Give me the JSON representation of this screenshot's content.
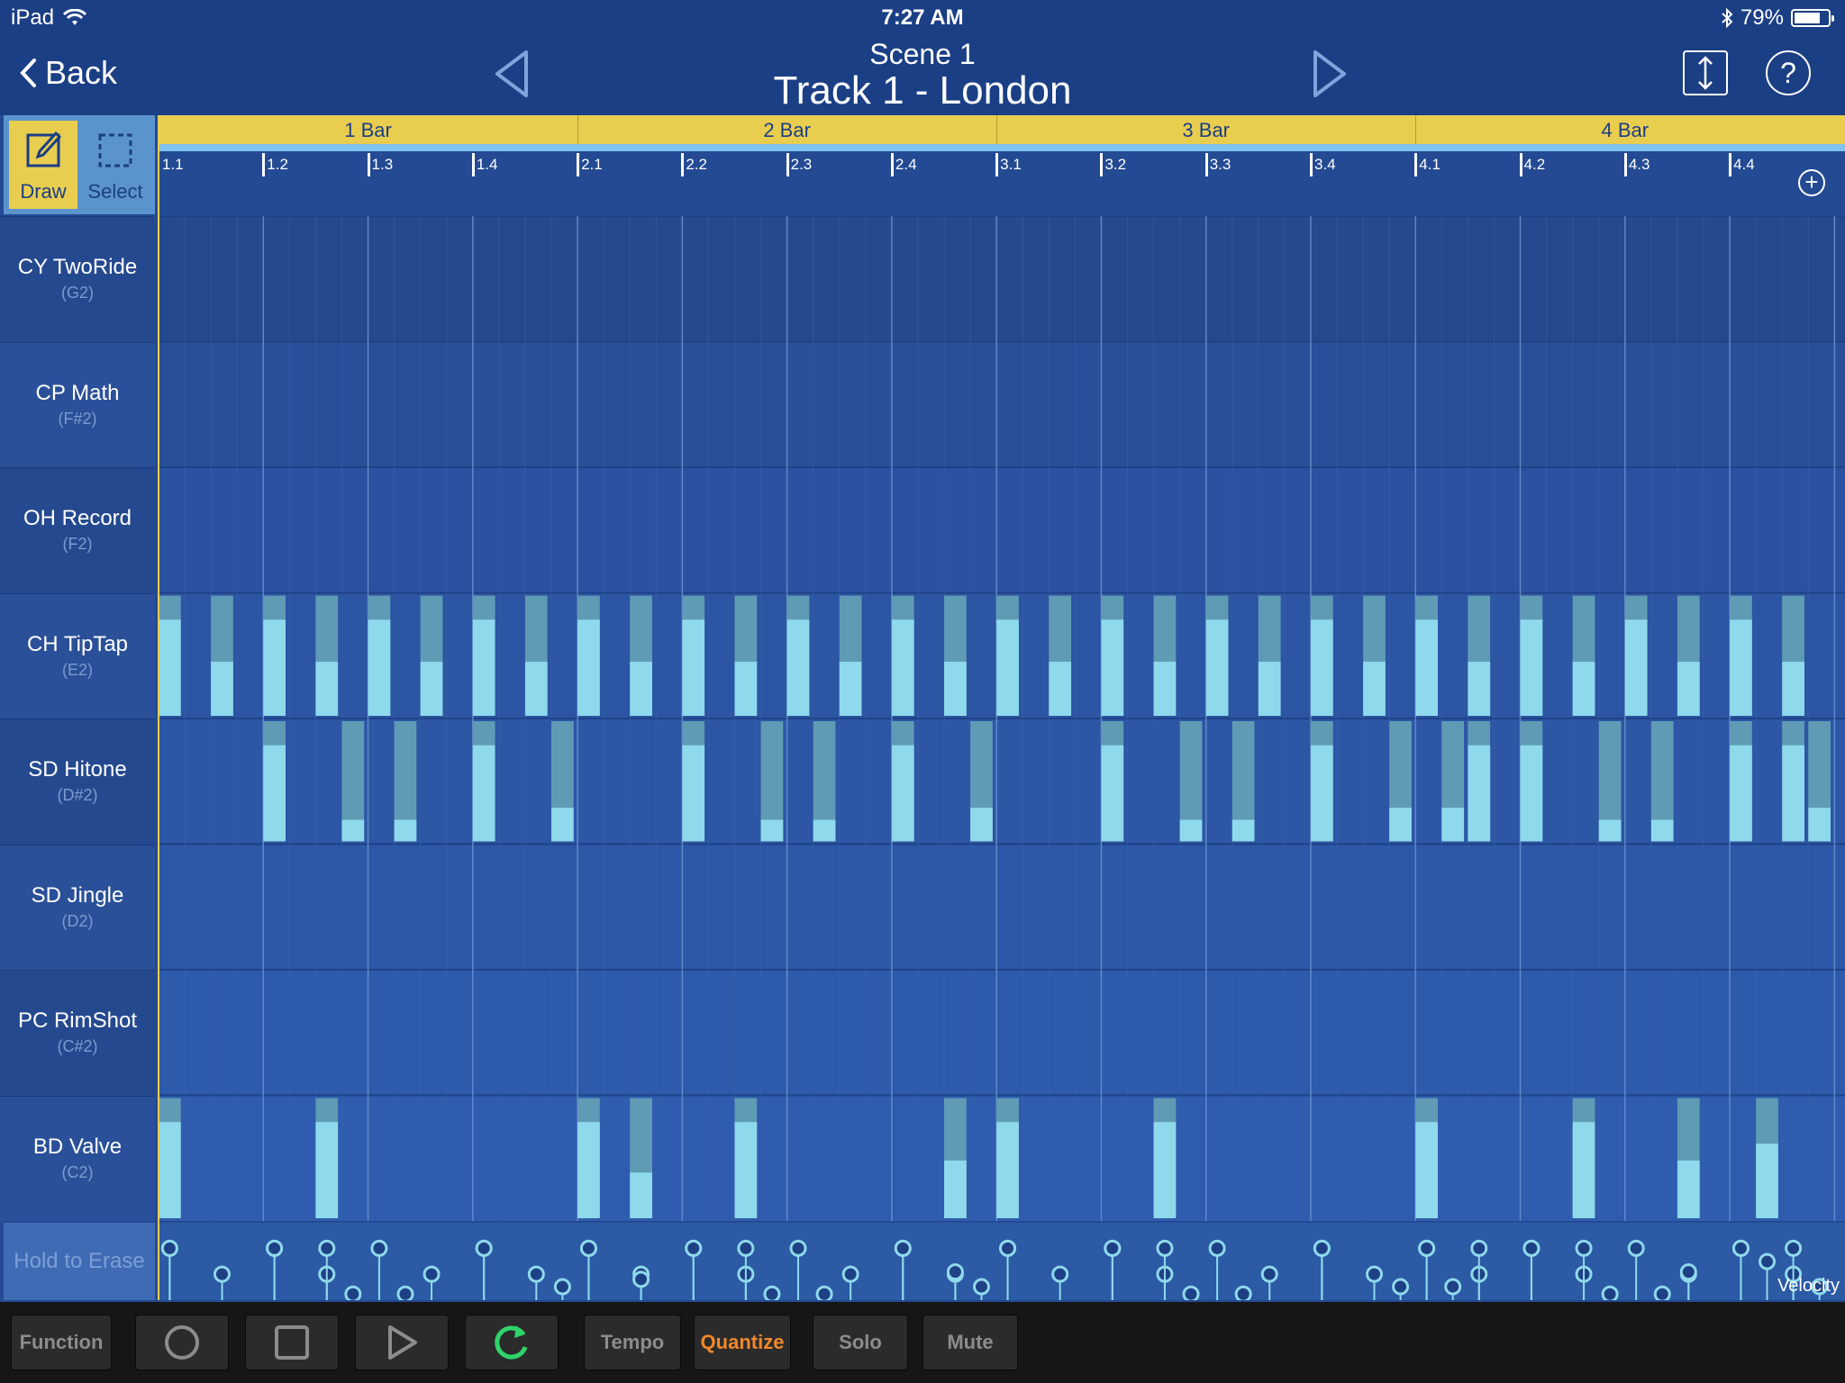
{
  "status_bar": {
    "device": "iPad",
    "time": "7:27 AM",
    "battery": "79%",
    "battery_level": 0.79
  },
  "nav": {
    "back_label": "Back",
    "scene": "Scene  1",
    "track_title": "Track 1 - London"
  },
  "tools": {
    "draw": "Draw",
    "select": "Select"
  },
  "bars": [
    "1 Bar",
    "2 Bar",
    "3 Bar",
    "4 Bar"
  ],
  "beats": [
    "1.1",
    "1.2",
    "1.3",
    "1.4",
    "2.1",
    "2.2",
    "2.3",
    "2.4",
    "3.1",
    "3.2",
    "3.3",
    "3.4",
    "4.1",
    "4.2",
    "4.3",
    "4.4"
  ],
  "instruments": [
    {
      "name": "CY TwoRide",
      "note": "(G2)"
    },
    {
      "name": "CP Math",
      "note": "(F#2)"
    },
    {
      "name": "OH Record",
      "note": "(F2)"
    },
    {
      "name": "CH TipTap",
      "note": "(E2)"
    },
    {
      "name": "SD Hitone",
      "note": "(D#2)"
    },
    {
      "name": "SD Jingle",
      "note": "(D2)"
    },
    {
      "name": "PC RimShot",
      "note": "(C#2)"
    },
    {
      "name": "BD Valve",
      "note": "(C2)"
    }
  ],
  "hold_to_erase": "Hold to Erase",
  "velocity_label": "Velocity",
  "colors": {
    "accent": "#e9cd4f",
    "note_fill": "#8fd9ec",
    "note_dim": "#5f9bb5",
    "quantize": "#f2882b"
  },
  "toolbar": {
    "function": "Function",
    "tempo": "Tempo",
    "quantize": "Quantize",
    "solo": "Solo",
    "mute": "Mute"
  },
  "pattern": [
    {
      "row": 3,
      "notes": [
        {
          "s": 0,
          "v": 0.8
        },
        {
          "s": 2,
          "v": 0.45
        },
        {
          "s": 4,
          "v": 0.8
        },
        {
          "s": 6,
          "v": 0.45
        },
        {
          "s": 8,
          "v": 0.8
        },
        {
          "s": 10,
          "v": 0.45
        },
        {
          "s": 12,
          "v": 0.8
        },
        {
          "s": 14,
          "v": 0.45
        },
        {
          "s": 16,
          "v": 0.8
        },
        {
          "s": 18,
          "v": 0.45
        },
        {
          "s": 20,
          "v": 0.8
        },
        {
          "s": 22,
          "v": 0.45
        },
        {
          "s": 24,
          "v": 0.8
        },
        {
          "s": 26,
          "v": 0.45
        },
        {
          "s": 28,
          "v": 0.8
        },
        {
          "s": 30,
          "v": 0.45
        },
        {
          "s": 32,
          "v": 0.8
        },
        {
          "s": 34,
          "v": 0.45
        },
        {
          "s": 36,
          "v": 0.8
        },
        {
          "s": 38,
          "v": 0.45
        },
        {
          "s": 40,
          "v": 0.8
        },
        {
          "s": 42,
          "v": 0.45
        },
        {
          "s": 44,
          "v": 0.8
        },
        {
          "s": 46,
          "v": 0.45
        },
        {
          "s": 48,
          "v": 0.8
        },
        {
          "s": 50,
          "v": 0.45
        },
        {
          "s": 52,
          "v": 0.8
        },
        {
          "s": 54,
          "v": 0.45
        },
        {
          "s": 56,
          "v": 0.8
        },
        {
          "s": 58,
          "v": 0.45
        },
        {
          "s": 60,
          "v": 0.8
        },
        {
          "s": 62,
          "v": 0.45
        }
      ]
    },
    {
      "row": 4,
      "notes": [
        {
          "s": 4,
          "v": 0.8
        },
        {
          "s": 7,
          "v": 0.18
        },
        {
          "s": 9,
          "v": 0.18
        },
        {
          "s": 12,
          "v": 0.8
        },
        {
          "s": 15,
          "v": 0.28
        },
        {
          "s": 20,
          "v": 0.8
        },
        {
          "s": 23,
          "v": 0.18
        },
        {
          "s": 25,
          "v": 0.18
        },
        {
          "s": 28,
          "v": 0.8
        },
        {
          "s": 31,
          "v": 0.28
        },
        {
          "s": 36,
          "v": 0.8
        },
        {
          "s": 39,
          "v": 0.18
        },
        {
          "s": 41,
          "v": 0.18
        },
        {
          "s": 44,
          "v": 0.8
        },
        {
          "s": 47,
          "v": 0.28
        },
        {
          "s": 49,
          "v": 0.28
        },
        {
          "s": 50,
          "v": 0.8
        },
        {
          "s": 52,
          "v": 0.8
        },
        {
          "s": 55,
          "v": 0.18
        },
        {
          "s": 57,
          "v": 0.18
        },
        {
          "s": 60,
          "v": 0.8
        },
        {
          "s": 62,
          "v": 0.8
        },
        {
          "s": 63,
          "v": 0.28
        }
      ]
    },
    {
      "row": 7,
      "notes": [
        {
          "s": 0,
          "v": 0.8
        },
        {
          "s": 6,
          "v": 0.8
        },
        {
          "s": 16,
          "v": 0.8
        },
        {
          "s": 18,
          "v": 0.38
        },
        {
          "s": 22,
          "v": 0.8
        },
        {
          "s": 30,
          "v": 0.48
        },
        {
          "s": 32,
          "v": 0.8
        },
        {
          "s": 38,
          "v": 0.8
        },
        {
          "s": 48,
          "v": 0.8
        },
        {
          "s": 54,
          "v": 0.8
        },
        {
          "s": 58,
          "v": 0.48
        },
        {
          "s": 61,
          "v": 0.62
        }
      ]
    }
  ]
}
